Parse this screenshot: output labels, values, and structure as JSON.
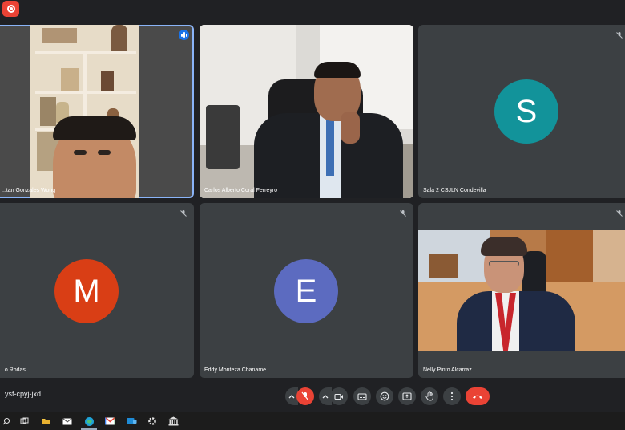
{
  "window": {
    "recording_icon": "record-icon"
  },
  "participants": [
    {
      "name": "...tan Gonzales Wong",
      "type": "video",
      "speaking": true
    },
    {
      "name": "Carlos Alberto Coral Ferreyro",
      "type": "video",
      "muted": false
    },
    {
      "name": "Sala 2 CSJLN Condevilla",
      "type": "avatar",
      "initial": "S",
      "color": "#12939a",
      "muted": true
    },
    {
      "name": "...o Rodas",
      "type": "avatar",
      "initial": "M",
      "color": "#d93e15",
      "muted": true
    },
    {
      "name": "Eddy Monteza Chaname",
      "type": "avatar",
      "initial": "E",
      "color": "#5c6bc0",
      "muted": true
    },
    {
      "name": "Nelly Pinto Alcarraz",
      "type": "video",
      "muted": true
    }
  ],
  "meeting": {
    "code": "ysf-cpyj-jxd"
  },
  "controls": {
    "mic": "mic-off-icon",
    "camera": "camera-icon",
    "captions": "captions-icon",
    "emoji": "emoji-icon",
    "present": "present-icon",
    "raise_hand": "raise-hand-icon",
    "more": "more-vert-icon",
    "leave": "hang-up-icon"
  },
  "taskbar": {
    "icons": [
      "search-icon",
      "task-view-icon",
      "file-explorer-icon",
      "mail-icon",
      "edge-icon",
      "gmail-icon",
      "teams-icon",
      "settings-icon",
      "bank-icon"
    ]
  }
}
